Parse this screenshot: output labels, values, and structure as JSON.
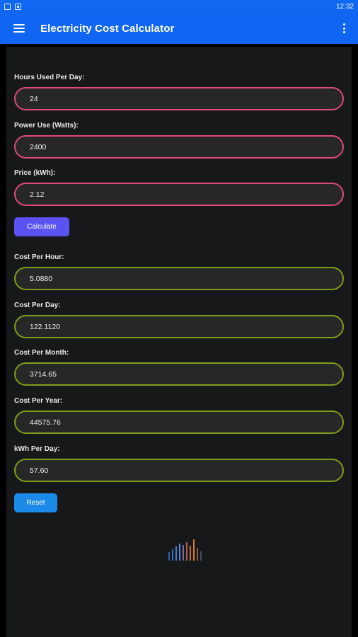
{
  "status_bar": {
    "time": "12:32"
  },
  "app_bar": {
    "title": "Electricity Cost Calculator"
  },
  "inputs": [
    {
      "label": "Hours Used Per Day:",
      "value": "24"
    },
    {
      "label": "Power Use (Watts):",
      "value": "2400"
    },
    {
      "label": "Price (kWh):",
      "value": "2.12"
    }
  ],
  "calculate_label": "Calculate",
  "outputs": [
    {
      "label": "Cost Per Hour:",
      "value": "5.0880"
    },
    {
      "label": "Cost Per Day:",
      "value": "122.1120"
    },
    {
      "label": "Cost Per Month:",
      "value": "3714.65"
    },
    {
      "label": "Cost Per Year:",
      "value": "44575.76"
    },
    {
      "label": "kWh Per Day:",
      "value": "57.60"
    }
  ],
  "reset_label": "Reset",
  "colors": {
    "app_bar": "#1065f3",
    "input_border": "#e0497c",
    "output_border": "#7e9d1c",
    "calculate_button": "#5b52f2",
    "reset_button": "#1c8ae8"
  }
}
